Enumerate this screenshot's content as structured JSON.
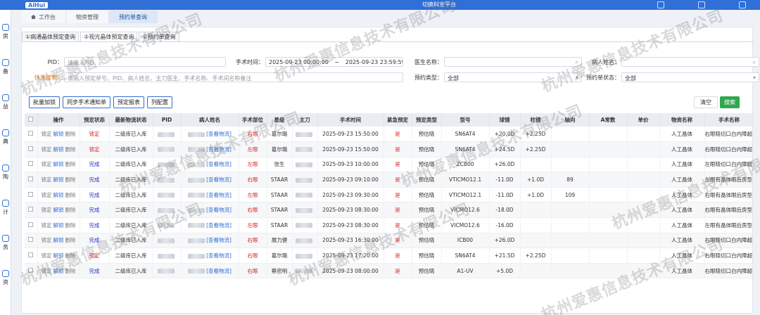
{
  "topbar": {
    "logo_text": "AiHui",
    "right_text": "切换科室平台"
  },
  "sidebar": {
    "items": [
      "房",
      "备",
      "益",
      "典",
      "陶",
      "计",
      "务",
      "资"
    ]
  },
  "nav_tabs": [
    {
      "label": "工作台",
      "active": false
    },
    {
      "label": "物资管理",
      "active": false
    },
    {
      "label": "预约单查询",
      "active": true
    }
  ],
  "sub_tabs": [
    {
      "label": "①病通晶体预定查询",
      "active": false
    },
    {
      "label": "②视光晶体预定查询",
      "active": true
    },
    {
      "label": "①预约单查询",
      "active": false
    }
  ],
  "filters": {
    "pid_label": "PID：",
    "pid_placeholder": "请输入PID",
    "time_label": "手术时间：",
    "time_start": "2025-09-23 00:00:00",
    "time_sep": "~",
    "time_end": "2025-09-23 23:59:59",
    "doctor_label": "医生名称：",
    "patient_label": "病人姓名：",
    "quick_label": "快速搜索：",
    "quick_placeholder": "请输入预定单号、PID、病人姓名、主刀医生、手术名称、手术间名称备注",
    "booking_type_label": "预约类型：",
    "booking_type_value": "全部",
    "booking_status_label": "预约单状态：",
    "booking_status_value": "全部"
  },
  "buttons": {
    "batch_lock": "批量加锁",
    "sync_notice": "同步手术通知单",
    "booking_report": "预定报表",
    "column_config": "列配置",
    "clear": "清空",
    "search": "搜索"
  },
  "table": {
    "headers": [
      "",
      "操作",
      "预定状态",
      "最新物流状态",
      "PID",
      "病人姓名",
      "手术部位",
      "星级",
      "主刀",
      "手术时间",
      "紧急预定",
      "预定类型",
      "型号",
      "球镜",
      "柱镜",
      "轴向",
      "A常数",
      "单价",
      "物资名称",
      "手术名称"
    ],
    "ops": [
      "锁定",
      "解锁",
      "删除"
    ],
    "logistics_link": "[查看物流]",
    "rows": [
      {
        "status": "锁定",
        "status_color": "red",
        "logistics": "二级库已入库",
        "side": "右眼",
        "doctor": "葛尔璐",
        "time": "2025-09-23 15:50:00",
        "urgent": "是",
        "btype": "预估晓",
        "model": "SN6AT4",
        "sph": "+20.0D",
        "cyl": "+2.25D",
        "axis": "",
        "a": "",
        "price": "",
        "item": "人工晶体",
        "surgery": "右眼晓切口白内障超声"
      },
      {
        "status": "锁定",
        "status_color": "red",
        "logistics": "二级库已入库",
        "side": "左眼",
        "doctor": "葛尔璐",
        "time": "2025-09-23 15:50:00",
        "urgent": "是",
        "btype": "预估晓",
        "model": "SN6AT4",
        "sph": "+24.5D",
        "cyl": "+2.25D",
        "axis": "",
        "a": "",
        "price": "",
        "item": "人工晶体",
        "surgery": "右眼晓切口白内障超声"
      },
      {
        "status": "完成",
        "status_color": "blue",
        "logistics": "二级库已入库",
        "side": "左眼",
        "doctor": "张生",
        "time": "2025-09-23 10:00:00",
        "urgent": "是",
        "btype": "预估晓",
        "model": "ZCB00",
        "sph": "+26.0D",
        "cyl": "",
        "axis": "",
        "a": "",
        "price": "",
        "item": "人工晶体",
        "surgery": "左眼晓切口白内障超声"
      },
      {
        "status": "完成",
        "status_color": "blue",
        "logistics": "二级库已入库",
        "side": "右眼",
        "doctor": "STAAR",
        "time": "2025-09-23 09:10:00",
        "urgent": "是",
        "btype": "预估晓",
        "model": "VTICMO12.1",
        "sph": "-11.0D",
        "cyl": "+1.0D",
        "axis": "89",
        "a": "",
        "price": "",
        "item": "人工晶体",
        "surgery": "左眼有晶体眼后房型人"
      },
      {
        "status": "完成",
        "status_color": "blue",
        "logistics": "二级库已入库",
        "side": "左眼",
        "doctor": "STAAR",
        "time": "2025-09-23 09:30:00",
        "urgent": "是",
        "btype": "预估晓",
        "model": "VTICMO12.1",
        "sph": "-11.0D",
        "cyl": "+1.0D",
        "axis": "109",
        "a": "",
        "price": "",
        "item": "人工晶体",
        "surgery": "右眼有晶体眼后房型人"
      },
      {
        "status": "完成",
        "status_color": "blue",
        "logistics": "二级库已入库",
        "side": "右眼",
        "doctor": "STAAR",
        "time": "2025-09-23 08:30:00",
        "urgent": "是",
        "btype": "预估晓",
        "model": "VICMO12.6",
        "sph": "-18.0D",
        "cyl": "",
        "axis": "",
        "a": "",
        "price": "",
        "item": "人工晶体",
        "surgery": "右眼有晶体眼后房型人"
      },
      {
        "status": "完成",
        "status_color": "blue",
        "logistics": "二级库已入库",
        "side": "左眼",
        "doctor": "STAAR",
        "time": "2025-09-23 08:30:00",
        "urgent": "是",
        "btype": "预估晓",
        "model": "VICMO12.6",
        "sph": "-16.0D",
        "cyl": "",
        "axis": "",
        "a": "",
        "price": "",
        "item": "人工晶体",
        "surgery": "左眼有晶体眼后房型人"
      },
      {
        "status": "完成",
        "status_color": "blue",
        "logistics": "二级库已入库",
        "side": "右眼",
        "doctor": "展力健",
        "time": "2025-09-23 16:30:00",
        "urgent": "是",
        "btype": "预估晓",
        "model": "ICB00",
        "sph": "+26.0D",
        "cyl": "",
        "axis": "",
        "a": "",
        "price": "",
        "item": "人工晶体",
        "surgery": "右眼晓切口白内障超声"
      },
      {
        "status": "锁定",
        "status_color": "red",
        "logistics": "二级库已入库",
        "side": "右眼",
        "doctor": "葛尔璐",
        "time": "2025-09-23 17:20:00",
        "urgent": "是",
        "btype": "预估晓",
        "model": "SN6AT4",
        "sph": "+21.5D",
        "cyl": "+2.25D",
        "axis": "",
        "a": "",
        "price": "",
        "item": "人工晶体",
        "surgery": "右眼晓切口白内障超声"
      },
      {
        "status": "完成",
        "status_color": "blue",
        "logistics": "二级库已入库",
        "side": "右眼",
        "doctor": "蔡密明",
        "time": "2025-09-23 08:00:00",
        "urgent": "是",
        "btype": "预估晓",
        "model": "A1-UV",
        "sph": "+5.0D",
        "cyl": "",
        "axis": "",
        "a": "",
        "price": "",
        "item": "人工晶体",
        "surgery": "右眼晓切口白内障超声"
      }
    ]
  },
  "watermark": "杭州爱惠信息技术有限公司",
  "colors": {
    "primary": "#2f6fd6",
    "danger": "#d8262b",
    "success": "#2fa84f"
  }
}
